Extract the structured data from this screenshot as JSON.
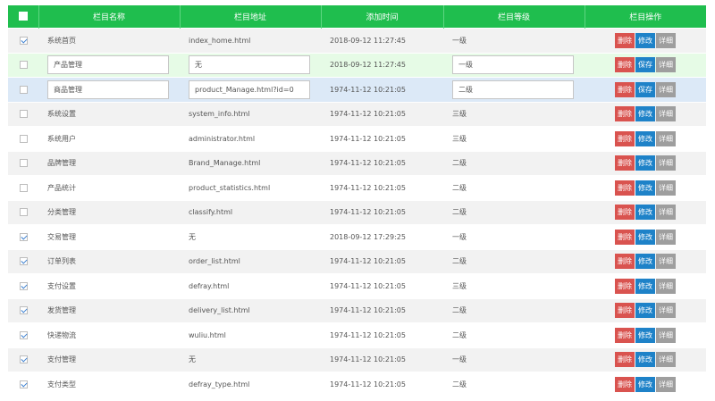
{
  "header": {
    "name": "栏目名称",
    "url": "栏目地址",
    "time": "添加时间",
    "level": "栏目等级",
    "ops": "栏目操作"
  },
  "buttons": {
    "delete": "删除",
    "modify": "修改",
    "save": "保存",
    "detail": "详细"
  },
  "rows": [
    {
      "checked": true,
      "name": "系统首页",
      "url": "index_home.html",
      "time": "2018-09-12 11:27:45",
      "level": "一级"
    },
    {
      "checked": false,
      "name": "产品管理",
      "url": "无",
      "time": "2018-09-12 11:27:45",
      "level": "一级",
      "editing": "green"
    },
    {
      "checked": false,
      "name": "商品管理",
      "url": "product_Manage.html?id=0",
      "time": "1974-11-12 10:21:05",
      "level": "二级",
      "editing": "blue"
    },
    {
      "checked": false,
      "name": "系统设置",
      "url": "system_info.html",
      "time": "1974-11-12 10:21:05",
      "level": "三级"
    },
    {
      "checked": false,
      "name": "系统用户",
      "url": "administrator.html",
      "time": "1974-11-12 10:21:05",
      "level": "三级"
    },
    {
      "checked": false,
      "name": "品牌管理",
      "url": "Brand_Manage.html",
      "time": "1974-11-12 10:21:05",
      "level": "二级"
    },
    {
      "checked": false,
      "name": "产品统计",
      "url": "product_statistics.html",
      "time": "1974-11-12 10:21:05",
      "level": "二级"
    },
    {
      "checked": false,
      "name": "分类管理",
      "url": "classify.html",
      "time": "1974-11-12 10:21:05",
      "level": "二级"
    },
    {
      "checked": true,
      "name": "交易管理",
      "url": "无",
      "time": "2018-09-12 17:29:25",
      "level": "一级"
    },
    {
      "checked": true,
      "name": "订单列表",
      "url": "order_list.html",
      "time": "1974-11-12 10:21:05",
      "level": "二级"
    },
    {
      "checked": true,
      "name": "支付设置",
      "url": "defray.html",
      "time": "1974-11-12 10:21:05",
      "level": "三级"
    },
    {
      "checked": true,
      "name": "发货管理",
      "url": "delivery_list.html",
      "time": "1974-11-12 10:21:05",
      "level": "二级"
    },
    {
      "checked": true,
      "name": "快递物流",
      "url": "wuliu.html",
      "time": "1974-11-12 10:21:05",
      "level": "二级"
    },
    {
      "checked": true,
      "name": "支付管理",
      "url": "无",
      "time": "1974-11-12 10:21:05",
      "level": "一级"
    },
    {
      "checked": true,
      "name": "支付类型",
      "url": "defray_type.html",
      "time": "1974-11-12 10:21:05",
      "level": "二级"
    }
  ],
  "colors": {
    "header_bg": "#1fbe4e",
    "delete": "#d9534f",
    "modify": "#1e82c8",
    "detail": "#9e9e9e",
    "edit_green_row": "#e6fbe6",
    "edit_blue_row": "#dce9f7"
  }
}
